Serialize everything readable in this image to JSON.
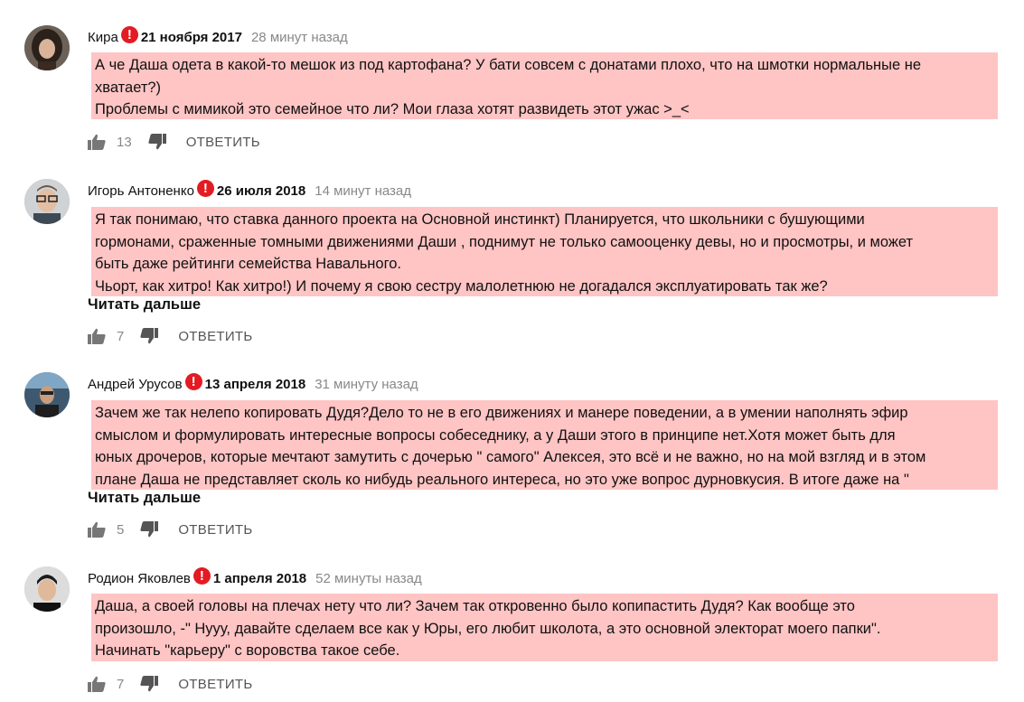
{
  "comments": [
    {
      "author": "Кира",
      "reg_date": "21 ноября 2017",
      "time": "28 минут назад",
      "lines": [
        "А че Даша одета в какой-то мешок из под картофана? У бати совсем с донатами плохо, что на шмотки нормальные не",
        "хватает?)",
        "Проблемы с мимикой это семейное что ли? Мои глаза хотят развидеть этот ужас >_<"
      ],
      "likes": "13",
      "reply_label": "ОТВЕТИТЬ"
    },
    {
      "author": "Игорь Антоненко",
      "reg_date": "26 июля 2018",
      "time": "14 минут назад",
      "lines": [
        "Я так понимаю, что ставка данного проекта на  Основной инстинкт) Планируется, что школьники с бушующими",
        "гормонами, сраженные томными движениями Даши , поднимут не только самооценку девы, но и просмотры, и  может",
        "быть даже рейтинги семейства Навального.",
        "Чьорт, как хитро! Как хитро!) И почему я свою сестру малолетнюю не догадался эксплуатировать так же?"
      ],
      "read_more": "Читать дальше",
      "likes": "7",
      "reply_label": "ОТВЕТИТЬ"
    },
    {
      "author": "Андрей Урусов",
      "reg_date": "13 апреля 2018",
      "time": "31 минуту назад",
      "lines": [
        "Зачем же так нелепо копировать Дудя?Дело то не в его движениях и манере поведении, а в умении наполнять эфир",
        "смыслом и формулировать интересные вопросы собеседнику, а у Даши этого в принципе нет.Хотя может быть для",
        "юных дрочеров, которые мечтают замутить с дочерью \" самого\" Алексея, это всё и не важно, но на мой взгляд и в этом",
        "плане Даша не представляет сколь ко нибудь реального интереса, но это уже вопрос дурновкусия. В итоге даже на \""
      ],
      "read_more": "Читать дальше",
      "likes": "5",
      "reply_label": "ОТВЕТИТЬ"
    },
    {
      "author": "Родион Яковлев",
      "reg_date": "1 апреля 2018",
      "time": "52 минуты назад",
      "lines": [
        "Даша, а своей головы на плечах нету что ли? Зачем так откровенно было копипастить Дудя? Как вообще это",
        "произошло, -\" Нууу, давайте сделаем все как у Юры, его любит школота, а это основной электорат моего папки\".",
        "Начинать \"карьеру\" с воровства такое себе."
      ],
      "likes": "7",
      "reply_label": "ОТВЕТИТЬ"
    }
  ],
  "warning_glyph": "!",
  "colors": {
    "highlight": "#ffc4c4",
    "warning": "#e31b23",
    "muted": "#888888"
  },
  "icons": {
    "like": "thumbs-up-icon",
    "dislike": "thumbs-down-icon",
    "warning": "warning-icon"
  }
}
